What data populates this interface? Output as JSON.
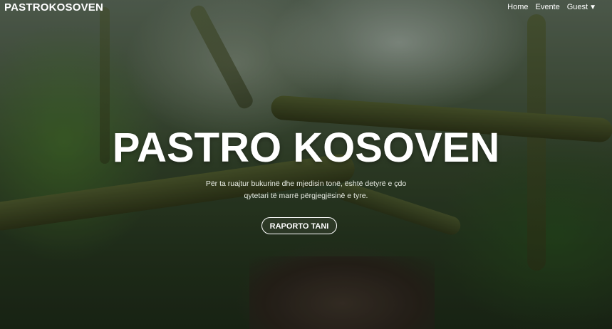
{
  "navbar": {
    "brand": "PASTROKOSOVEN",
    "links": [
      {
        "label": "Home"
      },
      {
        "label": "Evente"
      },
      {
        "label": "Guest",
        "caret": "▼"
      }
    ]
  },
  "hero": {
    "title": "PASTRO KOSOVEN",
    "subtitle_line1": "Për ta ruajtur bukurinë dhe mjedisin tonë, është detyrë e çdo",
    "subtitle_line2": "qytetari të marrë përgjegjësinë e tyre.",
    "cta_label": "RAPORTO TANI"
  },
  "colors": {
    "text": "#ffffff",
    "forest_dark": "#1d2a18",
    "forest_mid": "#34452b"
  }
}
